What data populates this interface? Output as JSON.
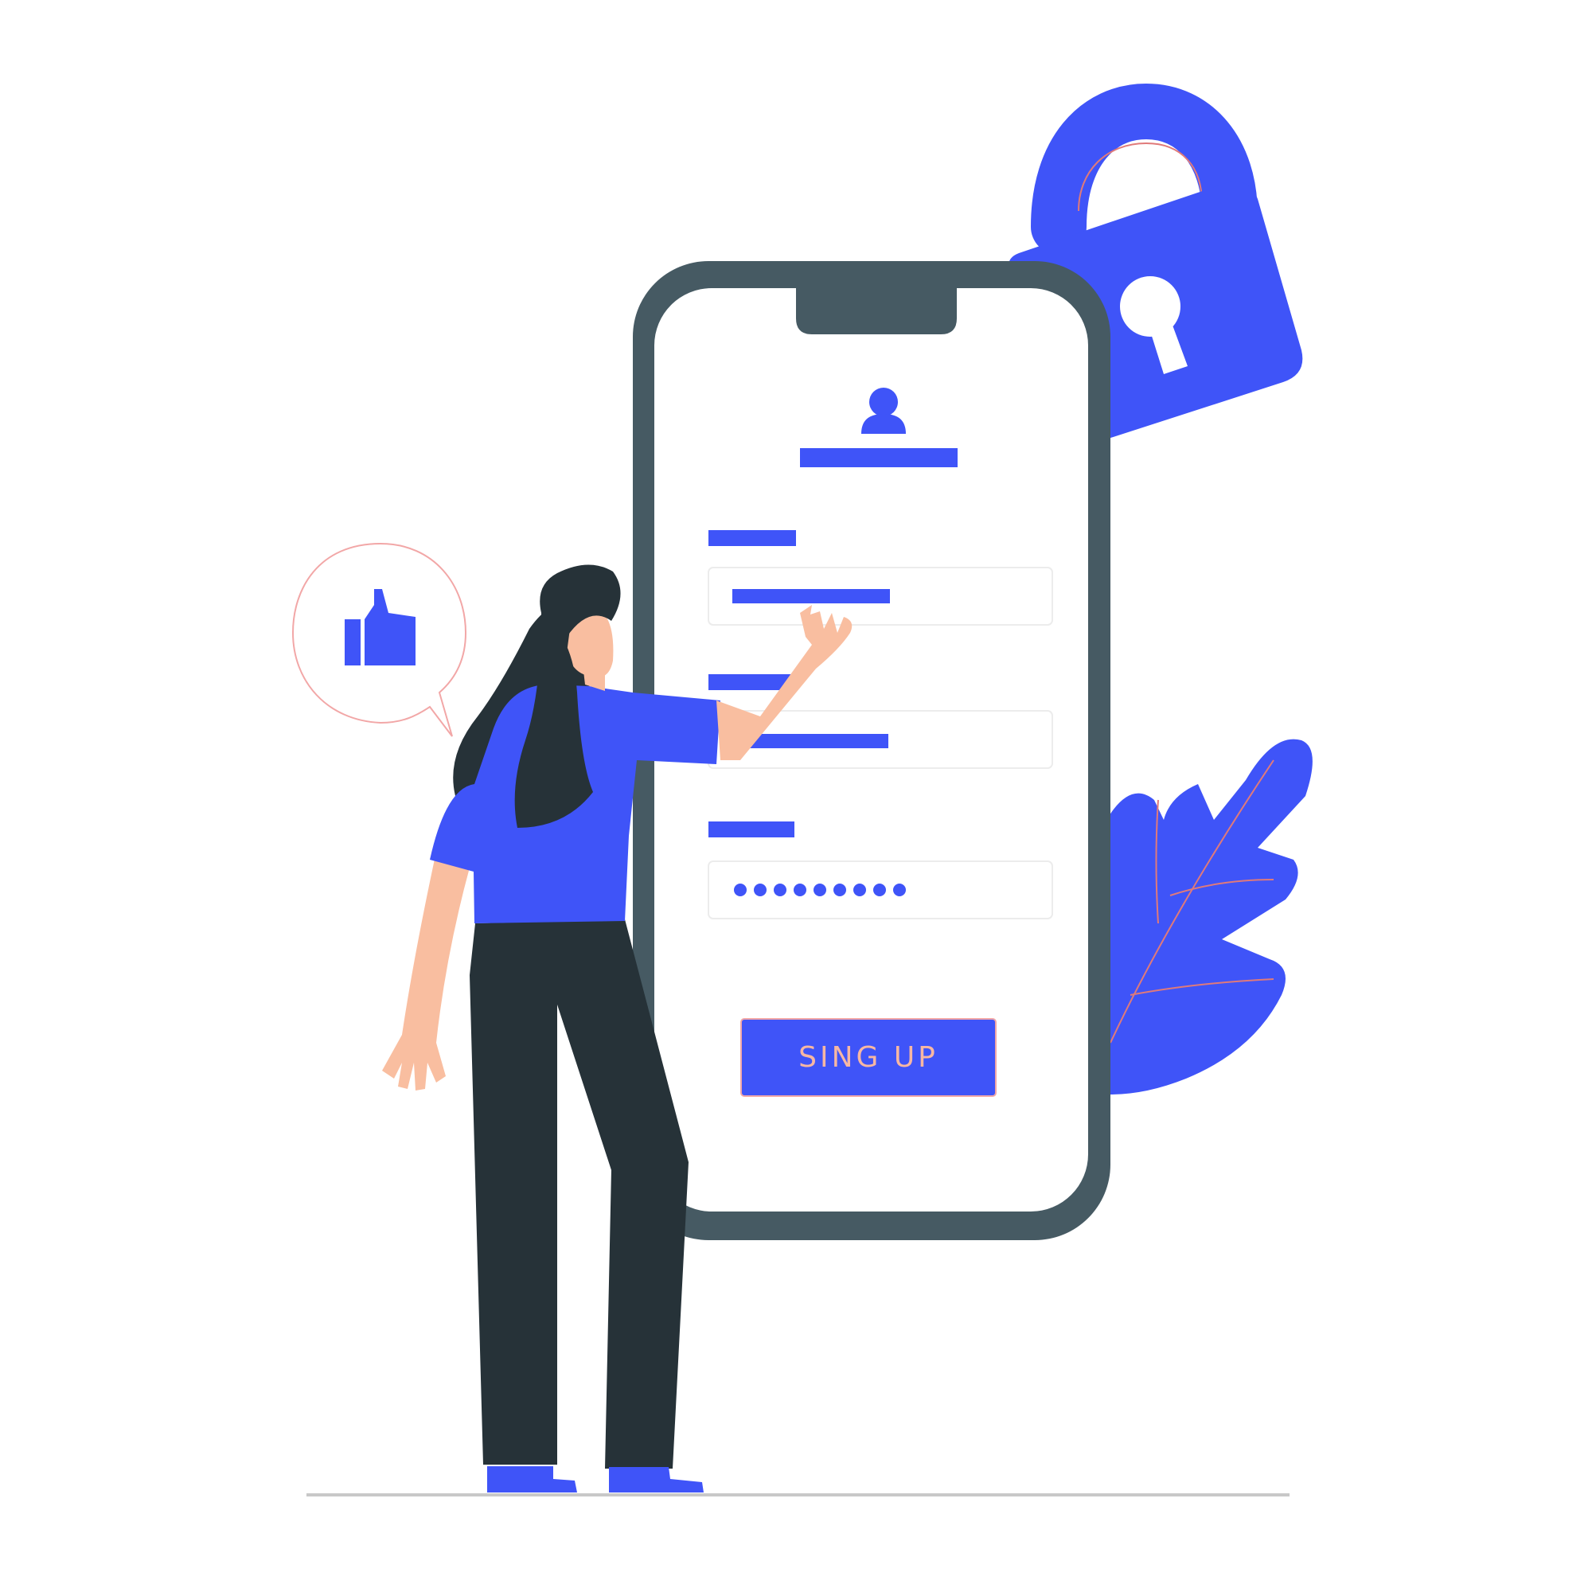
{
  "signup_button": {
    "label": "SING UP"
  },
  "password_field": {
    "masked_length": 9
  },
  "colors": {
    "accent": "#3f54f8",
    "frame": "#465a63",
    "hair_pants": "#263238",
    "skin": "#f9bea0",
    "field_border": "#ececec",
    "button_text": "#f7b7a3",
    "ground_line": "#c8c8c8",
    "bubble_outline": "#f2a7a7"
  },
  "icons": {
    "avatar": "user-icon",
    "thumbs_up": "thumbs-up-icon",
    "lock": "padlock-icon",
    "leaf": "leaf-icon"
  }
}
